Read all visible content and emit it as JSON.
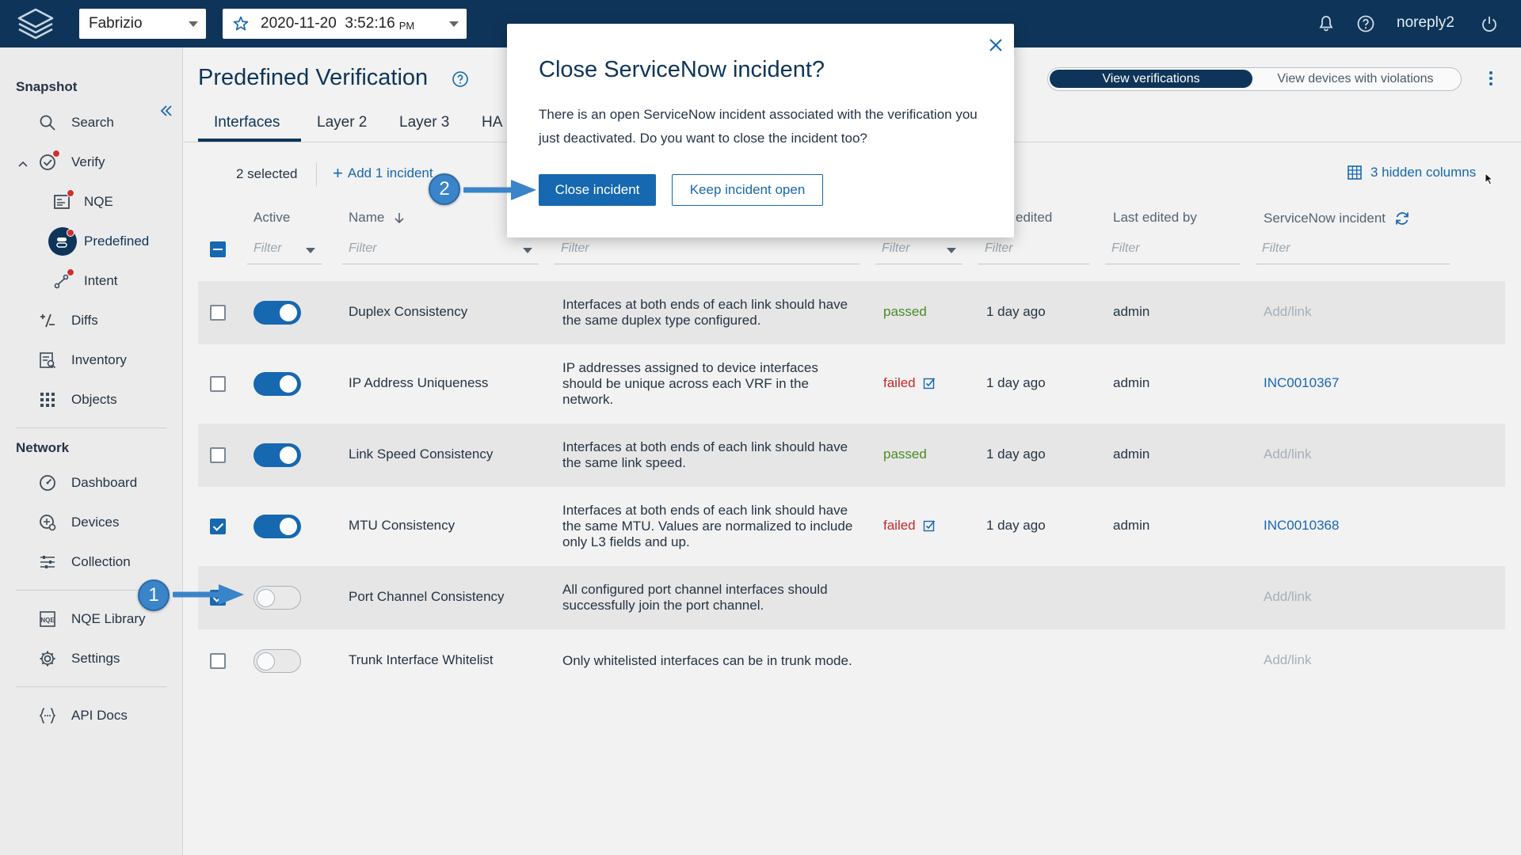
{
  "topbar": {
    "workspace": "Fabrizio",
    "snapshot_date": "2020-11-20  3:52:16",
    "snapshot_ampm": "PM",
    "user": "noreply2"
  },
  "sidebar": {
    "snapshot_heading": "Snapshot",
    "items_snapshot": [
      {
        "label": "Search",
        "icon": "search-icon"
      },
      {
        "label": "Verify",
        "icon": "verify-icon"
      },
      {
        "label": "NQE",
        "icon": "nqe-icon"
      },
      {
        "label": "Predefined",
        "icon": "predefined-icon"
      },
      {
        "label": "Intent",
        "icon": "intent-icon"
      },
      {
        "label": "Diffs",
        "icon": "diffs-icon"
      },
      {
        "label": "Inventory",
        "icon": "inventory-icon"
      },
      {
        "label": "Objects",
        "icon": "objects-icon"
      }
    ],
    "network_heading": "Network",
    "items_network": [
      {
        "label": "Dashboard",
        "icon": "dashboard-icon"
      },
      {
        "label": "Devices",
        "icon": "devices-icon"
      },
      {
        "label": "Collection",
        "icon": "collection-icon"
      }
    ],
    "items_other": [
      {
        "label": "NQE Library",
        "icon": "nqe-library-icon"
      },
      {
        "label": "Settings",
        "icon": "settings-icon"
      },
      {
        "label": "API Docs",
        "icon": "api-docs-icon"
      }
    ]
  },
  "page": {
    "title": "Predefined Verification",
    "view_verifications": "View verifications",
    "view_devices": "View devices with violations",
    "tabs": [
      "Interfaces",
      "Layer 2",
      "Layer 3",
      "HA"
    ],
    "selected_count": "2 selected",
    "add_incident": "Add 1 incident",
    "hidden_columns": "3 hidden columns"
  },
  "table": {
    "headers": {
      "active": "Active",
      "name": "Name",
      "last_edited": "edited",
      "last_edited_by": "Last edited by",
      "incident": "ServiceNow incident"
    },
    "filter_placeholder": "Filter",
    "rows": [
      {
        "checked": false,
        "active": true,
        "name": "Duplex Consistency",
        "desc": "Interfaces at both ends of each link should have the same duplex type configured.",
        "status": "passed",
        "edited": "1 day ago",
        "by": "admin",
        "incident": "Add/link",
        "incident_link": false
      },
      {
        "checked": false,
        "active": true,
        "name": "IP Address Uniqueness",
        "desc": "IP addresses assigned to device interfaces should be unique across each VRF in the network.",
        "status": "failed",
        "edited": "1 day ago",
        "by": "admin",
        "incident": "INC0010367",
        "incident_link": true
      },
      {
        "checked": false,
        "active": true,
        "name": "Link Speed Consistency",
        "desc": "Interfaces at both ends of each link should have the same link speed.",
        "status": "passed",
        "edited": "1 day ago",
        "by": "admin",
        "incident": "Add/link",
        "incident_link": false
      },
      {
        "checked": true,
        "active": true,
        "name": "MTU Consistency",
        "desc": "Interfaces at both ends of each link should have the same MTU. Values are normalized to include only L3 fields and up.",
        "status": "failed",
        "edited": "1 day ago",
        "by": "admin",
        "incident": "INC0010368",
        "incident_link": true
      },
      {
        "checked": true,
        "active": false,
        "name": "Port Channel Consistency",
        "desc": "All configured port channel interfaces should successfully join the port channel.",
        "status": "",
        "edited": "",
        "by": "",
        "incident": "Add/link",
        "incident_link": false
      },
      {
        "checked": false,
        "active": false,
        "name": "Trunk Interface Whitelist",
        "desc": "Only whitelisted interfaces can be in trunk mode.",
        "status": "",
        "edited": "",
        "by": "",
        "incident": "Add/link",
        "incident_link": false
      }
    ]
  },
  "dialog": {
    "title": "Close ServiceNow incident?",
    "body": "There is an open ServiceNow incident associated with the verification you just deactivated. Do you want to close the incident too?",
    "primary": "Close incident",
    "secondary": "Keep incident open"
  },
  "steps": [
    "1",
    "2"
  ],
  "colors": {
    "navy": "#0e3559",
    "accent": "#1668b0",
    "passed": "#4a8a2a",
    "failed": "#c62828"
  }
}
